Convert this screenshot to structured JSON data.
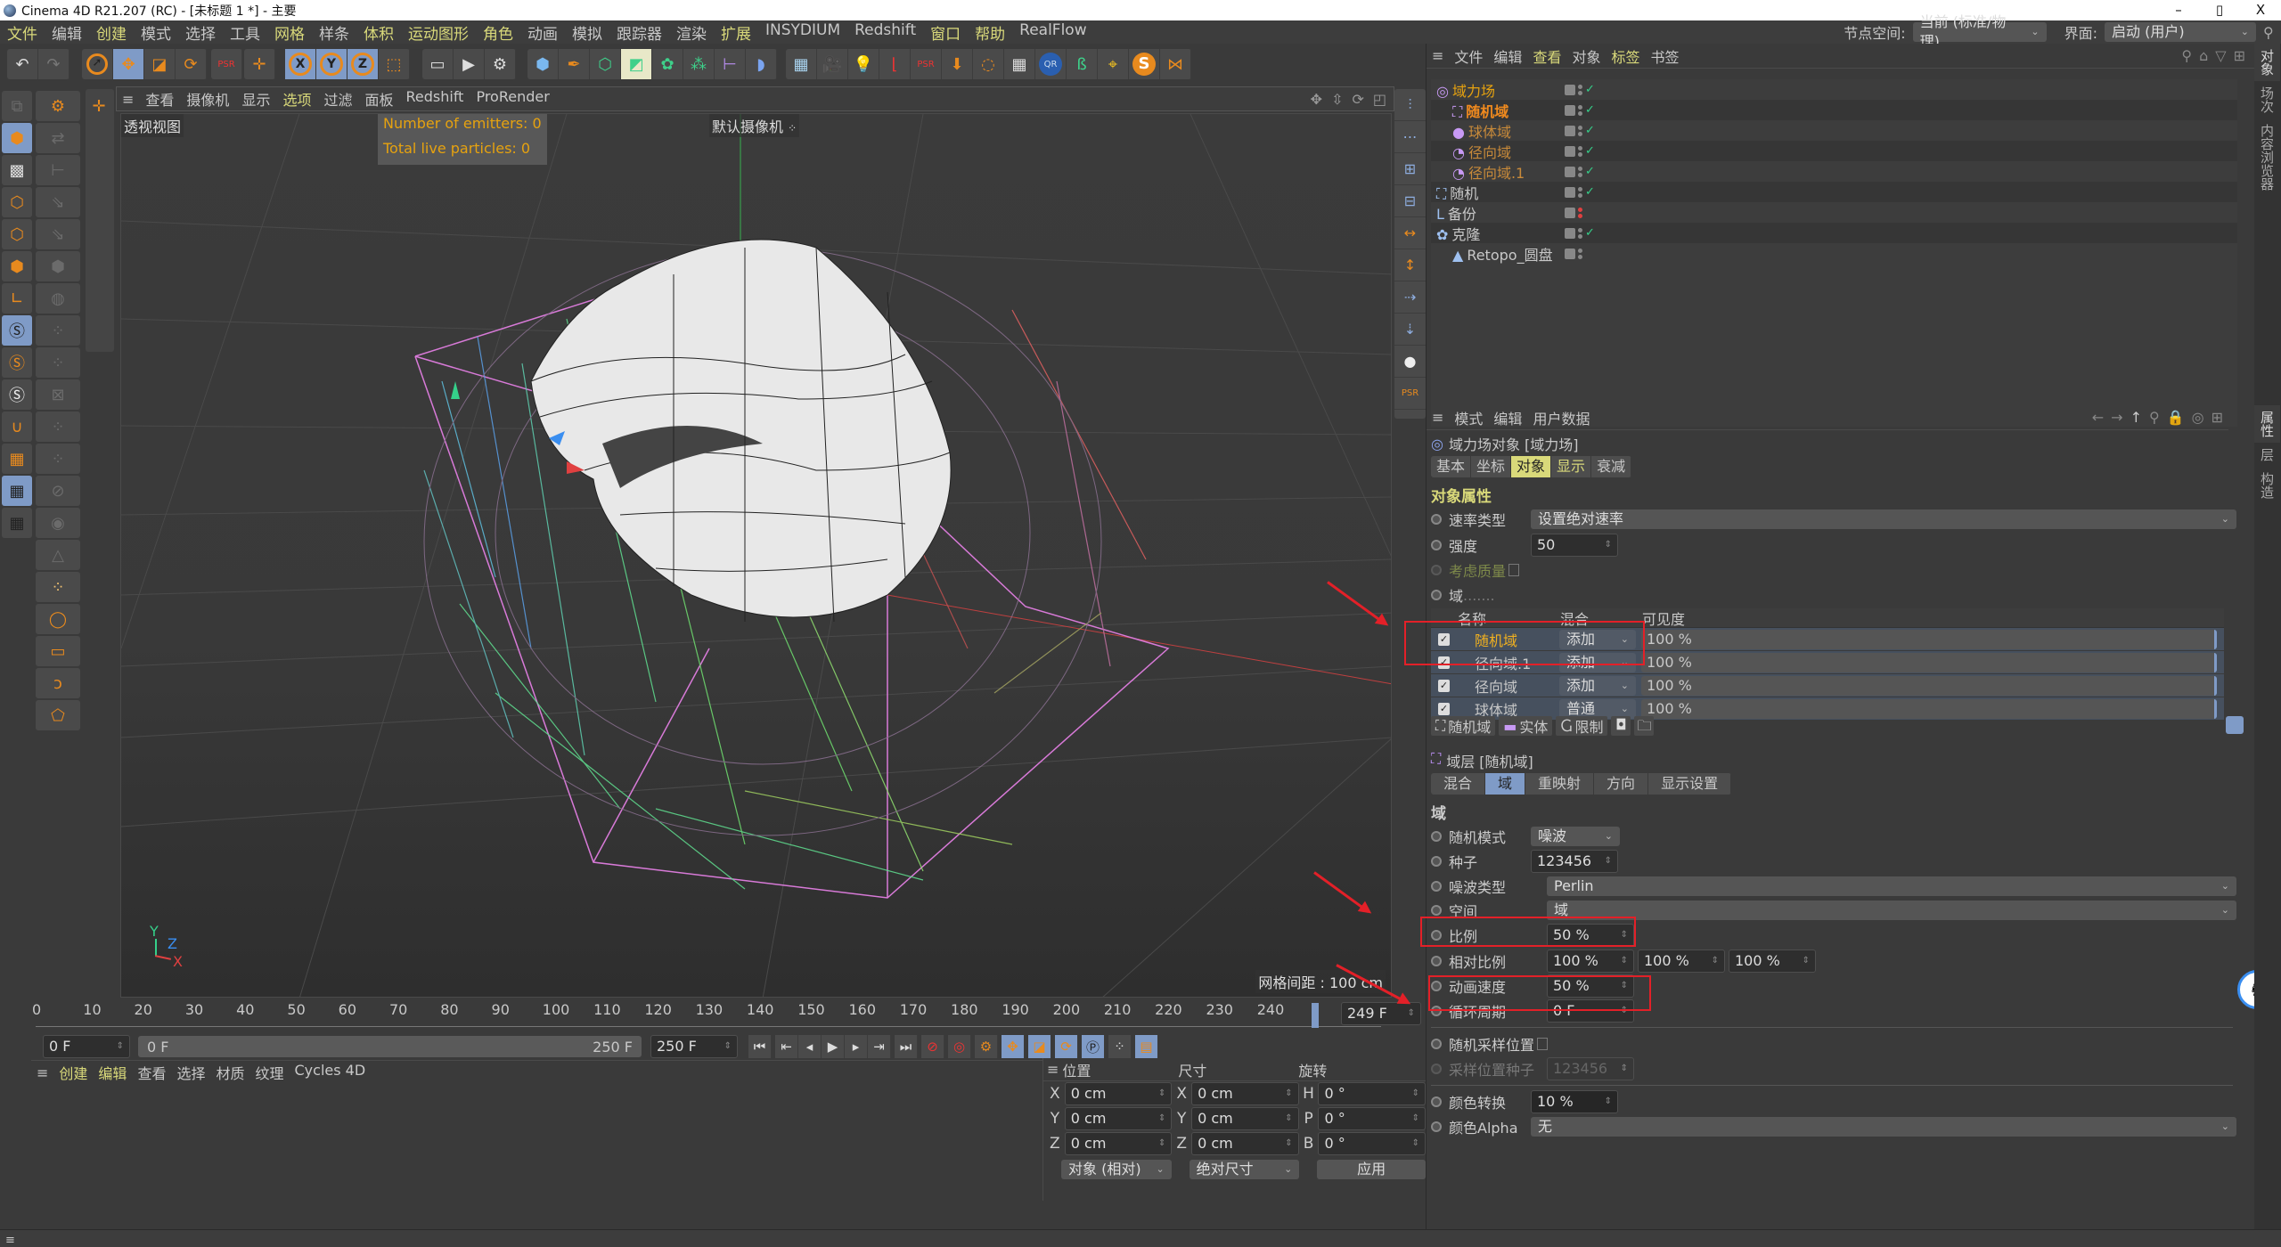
{
  "window": {
    "title": "Cinema 4D R21.207 (RC) - [未标题 1 *] - 主要",
    "controls": [
      "–",
      "▯",
      "X"
    ]
  },
  "menubar": {
    "items": [
      {
        "label": "文件",
        "hl": true
      },
      {
        "label": "编辑",
        "hl": false
      },
      {
        "label": "创建",
        "hl": true
      },
      {
        "label": "模式",
        "hl": false
      },
      {
        "label": "选择",
        "hl": false
      },
      {
        "label": "工具",
        "hl": false
      },
      {
        "label": "网格",
        "hl": true
      },
      {
        "label": "样条",
        "hl": false
      },
      {
        "label": "体积",
        "hl": true
      },
      {
        "label": "运动图形",
        "hl": true
      },
      {
        "label": "角色",
        "hl": true
      },
      {
        "label": "动画",
        "hl": false
      },
      {
        "label": "模拟",
        "hl": false
      },
      {
        "label": "跟踪器",
        "hl": false
      },
      {
        "label": "渲染",
        "hl": false
      },
      {
        "label": "扩展",
        "hl": true
      },
      {
        "label": "INSYDIUM",
        "hl": false
      },
      {
        "label": "Redshift",
        "hl": false
      },
      {
        "label": "窗口",
        "hl": true
      },
      {
        "label": "帮助",
        "hl": true
      },
      {
        "label": "RealFlow",
        "hl": false
      }
    ],
    "node_space_label": "节点空间:",
    "node_space_value": "当前 (标准/物理)",
    "layout_label": "界面:",
    "layout_value": "启动 (用户)"
  },
  "viewport": {
    "menu": [
      {
        "label": "查看",
        "hl": false
      },
      {
        "label": "摄像机",
        "hl": false
      },
      {
        "label": "显示",
        "hl": false
      },
      {
        "label": "选项",
        "hl": true
      },
      {
        "label": "过滤",
        "hl": false
      },
      {
        "label": "面板",
        "hl": false
      },
      {
        "label": "Redshift",
        "hl": false
      },
      {
        "label": "ProRender",
        "hl": false
      }
    ],
    "view_name": "透视视图",
    "camera_name": "默认摄像机",
    "emitters_text": "Number of emitters: 0",
    "particles_text": "Total live particles: 0",
    "grid_spacing": "网格间距 : 100 cm",
    "axis_labels": {
      "x": "X",
      "y": "Y",
      "z": "Z"
    }
  },
  "timeline": {
    "ticks": [
      "0",
      "10",
      "20",
      "30",
      "40",
      "50",
      "60",
      "70",
      "80",
      "90",
      "100",
      "110",
      "120",
      "130",
      "140",
      "150",
      "160",
      "170",
      "180",
      "190",
      "200",
      "210",
      "220",
      "230",
      "240"
    ],
    "current_frame_field": "249 F",
    "start_field": "0 F",
    "range_start": "0 F",
    "range_end": "250 F",
    "end_field": "250 F"
  },
  "material_panel": {
    "menu": [
      {
        "label": "创建",
        "hl": true
      },
      {
        "label": "编辑",
        "hl": true
      },
      {
        "label": "查看",
        "hl": false
      },
      {
        "label": "选择",
        "hl": false
      },
      {
        "label": "材质",
        "hl": false
      },
      {
        "label": "纹理",
        "hl": false
      },
      {
        "label": "Cycles 4D",
        "hl": false
      }
    ]
  },
  "coordinates": {
    "headers": {
      "position": "位置",
      "size": "尺寸",
      "rotation": "旋转"
    },
    "rows": [
      {
        "pl": "X",
        "pv": "0 cm",
        "sl": "X",
        "sv": "0 cm",
        "rl": "H",
        "rv": "0 °"
      },
      {
        "pl": "Y",
        "pv": "0 cm",
        "sl": "Y",
        "sv": "0 cm",
        "rl": "P",
        "rv": "0 °"
      },
      {
        "pl": "Z",
        "pv": "0 cm",
        "sl": "Z",
        "sv": "0 cm",
        "rl": "B",
        "rv": "0 °"
      }
    ],
    "mode_select": "对象 (相对)",
    "size_select": "绝对尺寸",
    "apply": "应用"
  },
  "object_manager": {
    "menu": [
      {
        "label": "文件",
        "hl": false
      },
      {
        "label": "编辑",
        "hl": false
      },
      {
        "label": "查看",
        "hl": true
      },
      {
        "label": "对象",
        "hl": false
      },
      {
        "label": "标签",
        "hl": true
      },
      {
        "label": "书签",
        "hl": false
      }
    ],
    "objects": [
      {
        "name": "域力场",
        "indent": 0,
        "color": "#e6a20f",
        "icon": "field-force-icon",
        "glyph": "◎",
        "status": "ok"
      },
      {
        "name": "随机域",
        "indent": 1,
        "color": "#f08a1e",
        "icon": "random-field-icon",
        "glyph": "⛶",
        "status": "ok",
        "bold": true
      },
      {
        "name": "球体域",
        "indent": 1,
        "color": "#c88a3a",
        "icon": "sphere-field-icon",
        "glyph": "●",
        "status": "ok"
      },
      {
        "name": "径向域",
        "indent": 1,
        "color": "#c88a3a",
        "icon": "radial-field-icon",
        "glyph": "◔",
        "status": "ok"
      },
      {
        "name": "径向域.1",
        "indent": 1,
        "color": "#c88a3a",
        "icon": "radial-field-icon",
        "glyph": "◔",
        "status": "ok"
      },
      {
        "name": "随机",
        "indent": 0,
        "color": "#c8c8c8",
        "icon": "random-effector-icon",
        "glyph": "⛶",
        "status": "ok"
      },
      {
        "name": "备份",
        "indent": 0,
        "color": "#c8c8c8",
        "icon": "null-backup-icon",
        "glyph": "L",
        "status": "off"
      },
      {
        "name": "克隆",
        "indent": 0,
        "color": "#c8c8c8",
        "icon": "cloner-icon",
        "glyph": "✿",
        "status": "ok"
      },
      {
        "name": "Retopo_圆盘",
        "indent": 1,
        "color": "#c8c8c8",
        "icon": "polygon-object-icon",
        "glyph": "▲",
        "status": "none"
      }
    ],
    "side_tabs": [
      "对象",
      "场次",
      "内容浏览器"
    ]
  },
  "attributes": {
    "menu": [
      {
        "label": "模式",
        "hl": false
      },
      {
        "label": "编辑",
        "hl": false
      },
      {
        "label": "用户数据",
        "hl": false
      }
    ],
    "object_title": "域力场对象 [域力场]",
    "tabs": [
      {
        "label": "基本",
        "state": ""
      },
      {
        "label": "坐标",
        "state": ""
      },
      {
        "label": "对象",
        "state": "on"
      },
      {
        "label": "显示",
        "state": "y"
      },
      {
        "label": "衰减",
        "state": ""
      }
    ],
    "section_title": "对象属性",
    "velocity_type_label": "速率类型",
    "velocity_type_value": "设置绝对速率",
    "strength_label": "强度",
    "strength_value": "50",
    "consider_mass_label": "考虑质量",
    "field_label": "域",
    "layer_table": {
      "headers": [
        "名称",
        "混合",
        "可见度"
      ],
      "rows": [
        {
          "name": "随机域",
          "blend": "添加",
          "visibility": "100 %",
          "selected": true
        },
        {
          "name": "径向域.1",
          "blend": "添加",
          "visibility": "100 %",
          "selected": false
        },
        {
          "name": "径向域",
          "blend": "添加",
          "visibility": "100 %",
          "selected": false
        },
        {
          "name": "球体域",
          "blend": "普通",
          "visibility": "100 %",
          "selected": false
        }
      ]
    },
    "layer_buttons": [
      {
        "label": "随机域",
        "icon": "random-field-icon"
      },
      {
        "label": "实体",
        "icon": "solid-layer-icon"
      },
      {
        "label": "限制",
        "icon": "clamp-layer-icon"
      }
    ],
    "layer_title": "域层 [随机域]",
    "layer_tabs": [
      {
        "label": "混合",
        "state": ""
      },
      {
        "label": "域",
        "state": "on2"
      },
      {
        "label": "重映射",
        "state": ""
      },
      {
        "label": "方向",
        "state": ""
      },
      {
        "label": "显示设置",
        "state": ""
      }
    ],
    "domain_section": "域",
    "random_mode_label": "随机模式",
    "random_mode_value": "噪波",
    "seed_label": "种子",
    "seed_value": "123456",
    "noise_type_label": "噪波类型",
    "noise_type_value": "Perlin",
    "space_label": "空间",
    "space_value": "域",
    "scale_label": "比例",
    "scale_value": "50 %",
    "relative_scale_label": "相对比例",
    "relative_scale_values": [
      "100 %",
      "100 %",
      "100 %"
    ],
    "anim_speed_label": "动画速度",
    "anim_speed_value": "50 %",
    "loop_period_label": "循环周期",
    "loop_period_value": "0 F",
    "random_sample_label": "随机采样位置",
    "sample_seed_label": "采样位置种子",
    "sample_seed_value": "123456",
    "color_shift_label": "颜色转换",
    "color_shift_value": "10 %",
    "color_alpha_label": "颜色Alpha",
    "color_alpha_value": "无",
    "side_tabs": [
      "属性",
      "层",
      "构造"
    ]
  },
  "colors": {
    "accent_yellow": "#d9d97a",
    "accent_orange": "#e88a1e",
    "selected_blue": "#7f9bc7",
    "annotation_red": "#e32028",
    "panel_bg": "#3a3a3a"
  }
}
